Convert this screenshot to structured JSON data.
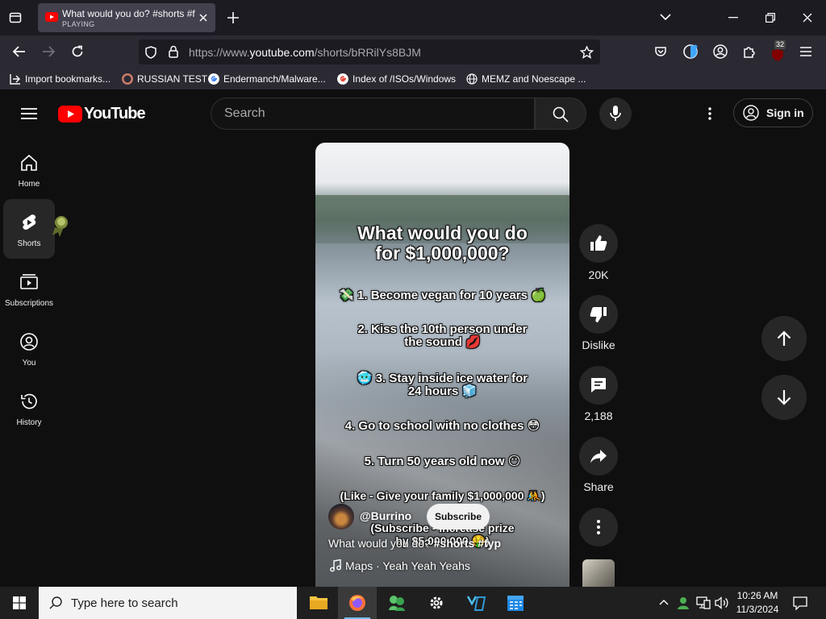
{
  "browser": {
    "tab": {
      "title": "What would you do? #shorts #f",
      "status": "PLAYING"
    },
    "url": {
      "scheme": "https://www.",
      "host": "youtube.com",
      "path": "/shorts/bRRilYs8BJM"
    },
    "extension_badge": "32",
    "bookmarks": [
      {
        "label": "Import bookmarks...",
        "icon": "import-icon"
      },
      {
        "label": "RUSSIAN TEST",
        "icon": "site-icon"
      },
      {
        "label": "Endermanch/Malware...",
        "icon": "google-icon"
      },
      {
        "label": "Index of /ISOs/Windows",
        "icon": "google-icon"
      },
      {
        "label": "MEMZ and Noescape ...",
        "icon": "globe-icon"
      }
    ]
  },
  "youtube": {
    "logo_text": "YouTube",
    "search": {
      "placeholder": "Search"
    },
    "sign_in_label": "Sign in",
    "sidebar": [
      {
        "label": "Home",
        "icon": "home-icon"
      },
      {
        "label": "Shorts",
        "icon": "shorts-icon",
        "active": true
      },
      {
        "label": "Subscriptions",
        "icon": "subscriptions-icon"
      },
      {
        "label": "You",
        "icon": "you-icon"
      },
      {
        "label": "History",
        "icon": "history-icon"
      }
    ],
    "short": {
      "title_line1": "What would you do",
      "title_line2": "for $1,000,000?",
      "lines": [
        "💸 1. Become vegan for 10 years 🍏",
        "2. Kiss the 10th person under",
        "the sound 💋",
        "🥶 3. Stay inside ice water for",
        "24 hours 🧊",
        "4. Go to school with no clothes 😳",
        "5. Turn 50 years old now 😶",
        "(Like - Give your family $1,000,000 🤼)",
        "(Subscribe - Increase prize",
        "by $5,000,000 🤑)"
      ],
      "channel": "@Burrino",
      "subscribe_label": "Subscribe",
      "description": "What would you do?",
      "hashtags": "#shorts #fyp",
      "music": "Maps · Yeah Yeah Yeahs"
    },
    "actions": {
      "likes": "20K",
      "dislike_label": "Dislike",
      "comments": "2,188",
      "share_label": "Share"
    }
  },
  "taskbar": {
    "search_placeholder": "Type here to search",
    "time": "10:26 AM",
    "date": "11/3/2024"
  }
}
